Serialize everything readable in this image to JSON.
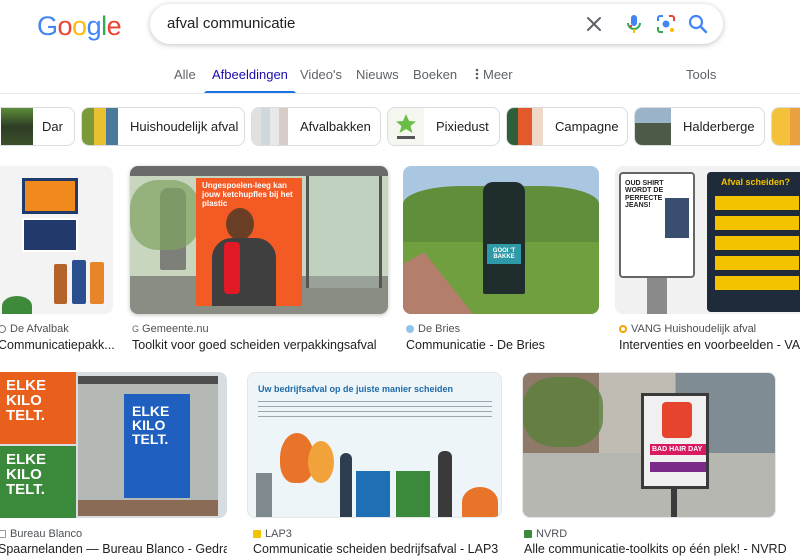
{
  "search": {
    "logo": "Google",
    "query": "afval communicatie"
  },
  "tabs": [
    {
      "label": "Alle"
    },
    {
      "label": "Afbeeldingen"
    },
    {
      "label": "Video's"
    },
    {
      "label": "Nieuws"
    },
    {
      "label": "Boeken"
    },
    {
      "label": "Meer"
    },
    {
      "label": "Tools"
    }
  ],
  "chips": [
    {
      "label": "Dar"
    },
    {
      "label": "Huishoudelijk afval"
    },
    {
      "label": "Afvalbakken"
    },
    {
      "label": "Pixiedust"
    },
    {
      "label": "Campagne"
    },
    {
      "label": "Halderberge"
    }
  ],
  "results": [
    {
      "source": "De Afvalbak",
      "title": "Communicatiepakk..."
    },
    {
      "source": "Gemeente.nu",
      "title": "Toolkit voor goed scheiden verpakkingsafval",
      "poster_heading": "Ungespoelen-leeg kan jouw ketchupfles bij het plastic"
    },
    {
      "source": "De Bries",
      "title": "Communicatie - De Bries",
      "poster_heading": "GOOI 'T BAKKE"
    },
    {
      "source": "VANG Huishoudelijk afval",
      "title": "Interventies en voorbeelden - VA...",
      "poster_heading": "Afval scheiden?",
      "sign_text": "OUD SHIRT WORDT DE PERFECTE JEANS!"
    },
    {
      "source": "Bureau Blanco",
      "title": "Spaarnelanden — Bureau Blanco - Gedra...",
      "poster_heading": "ELKE KILO TELT."
    },
    {
      "source": "LAP3",
      "title": "Communicatie scheiden bedrijfsafval - LAP3",
      "poster_heading": "Uw bedrijfsafval op de juiste manier scheiden"
    },
    {
      "source": "NVRD",
      "title": "Alle communicatie-toolkits op één plek! - NVRD",
      "poster_heading": "BAD HAIR DAY"
    }
  ]
}
